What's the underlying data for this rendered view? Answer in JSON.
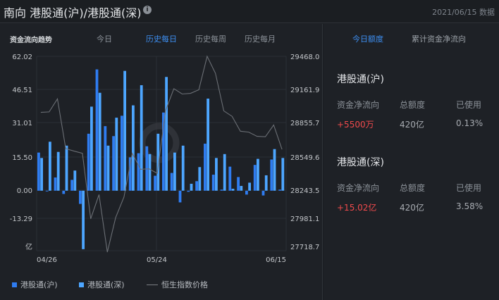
{
  "header": {
    "title": "南向 港股通(沪)/港股通(深)",
    "date": "2021/06/15 数据",
    "info_icon": "i"
  },
  "chart_panel": {
    "title": "资金流向趋势",
    "tabs": [
      "今日",
      "历史每日",
      "历史每周",
      "历史每月"
    ],
    "active_tab": 1
  },
  "chart_data": {
    "type": "bar",
    "title": "资金流向趋势",
    "left_ticks": [
      "62.02",
      "46.51",
      "31.01",
      "15.50",
      "0.00",
      "-13.29"
    ],
    "left_unit": "亿",
    "right_ticks": [
      "29468.0",
      "29161.9",
      "28855.7",
      "28549.6",
      "28243.5",
      "27981.1",
      "27718.7"
    ],
    "x_ticks": [
      "04/26",
      "05/24",
      "06/15"
    ],
    "ylim": [
      -27.7,
      62.02
    ],
    "ylim_right": [
      27718.7,
      29468.0
    ],
    "series": [
      {
        "name": "港股通(沪)",
        "color": "#2f7cf0",
        "values": [
          17.6,
          -0.2,
          6.1,
          -1.5,
          5.0,
          -6.1,
          26.3,
          56.0,
          29.8,
          25.2,
          34.6,
          15.4,
          17.3,
          20.5,
          6.9,
          36.1,
          8.2,
          -5.4,
          -0.5,
          4.4,
          21.7,
          7.4,
          0.5,
          11.1,
          6.3,
          -1.8,
          11.9,
          -2.2,
          14.4,
          0.5
        ]
      },
      {
        "name": "港股通(深)",
        "color": "#4da6ff",
        "values": [
          15.1,
          22.6,
          17.9,
          20.8,
          9.3,
          -27.0,
          38.8,
          45.2,
          20.8,
          33.7,
          55.3,
          39.4,
          48.7,
          16.9,
          26.3,
          52.5,
          17.6,
          20.8,
          3.2,
          10.9,
          42.5,
          15.1,
          16.9,
          0.9,
          2.2,
          3.7,
          14.7,
          7.1,
          19.2,
          15.1
        ]
      },
      {
        "name": "恒生指数价格",
        "color": "#6b6f75",
        "type": "line",
        "values": [
          28964,
          28968,
          29085,
          28637,
          28615,
          28595,
          28006,
          28224,
          27706,
          28017,
          28202,
          28595,
          28451,
          28456,
          28415,
          28980,
          29177,
          29129,
          29135,
          29167,
          29468,
          29315,
          28977,
          28928,
          28794,
          28786,
          28748,
          28744,
          28850,
          28631
        ]
      }
    ]
  },
  "legend": [
    "港股通(沪)",
    "港股通(深)",
    "恒生指数价格"
  ],
  "right_panel": {
    "tabs": [
      "今日额度",
      "累计资金净流向"
    ],
    "sections": [
      {
        "name": "港股通(沪)",
        "labels": [
          "资金净流向",
          "总额度",
          "已使用"
        ],
        "net": "+5500万",
        "quota": "420亿",
        "used": "0.13%"
      },
      {
        "name": "港股通(深)",
        "labels": [
          "资金净流向",
          "总额度",
          "已使用"
        ],
        "net": "+15.02亿",
        "quota": "420亿",
        "used": "3.58%"
      }
    ]
  }
}
